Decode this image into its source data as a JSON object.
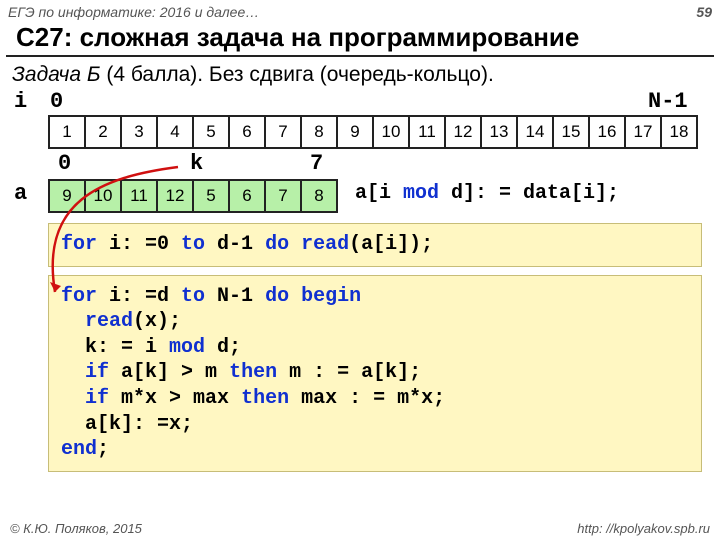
{
  "header": {
    "left": "ЕГЭ по информатике: 2016 и далее…",
    "page": "59"
  },
  "title": "C27: сложная задача на программирование",
  "subtitle": {
    "lead": "Задача Б",
    "rest": " (4 балла). Без сдвига (очередь-кольцо)."
  },
  "idx": {
    "i": "i",
    "zero": "0",
    "nminus": "N-1"
  },
  "row1": [
    "1",
    "2",
    "3",
    "4",
    "5",
    "6",
    "7",
    "8",
    "9",
    "10",
    "11",
    "12",
    "13",
    "14",
    "15",
    "16",
    "17",
    "18"
  ],
  "k": {
    "zero": "0",
    "k": "k",
    "seven": "7"
  },
  "a_label": "a",
  "row2": [
    "9",
    "10",
    "11",
    "12",
    "5",
    "6",
    "7",
    "8"
  ],
  "assign": {
    "pre": "a[i ",
    "kw": "mod",
    "mid": " d]: = data[i];"
  },
  "code1": {
    "l": "for i: =0 to d-1 do read(a[i]);"
  },
  "code2": {
    "l1": "for i: =d to N-1 do begin",
    "l2": "  read(x);",
    "l3": "  k: = i mod d;",
    "l4": "  if a[k] > m then m : = a[k];",
    "l5": "  if m*x > max then max : = m*x;",
    "l6": "  a[k]: =x;",
    "l7": "end;"
  },
  "footer": {
    "left": "© К.Ю. Поляков, 2015",
    "right": "http: //kpolyakov.spb.ru"
  }
}
